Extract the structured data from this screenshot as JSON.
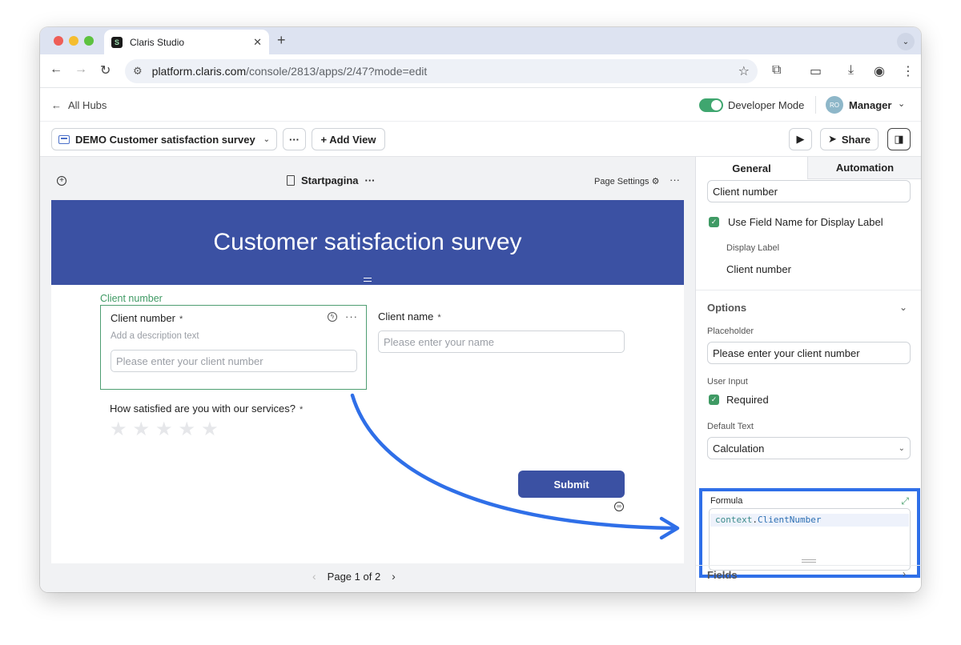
{
  "browser": {
    "tab_title": "Claris Studio",
    "tab_favicon": "S",
    "new_tab": "+",
    "tab_close": "✕",
    "url_host": "platform.claris.com",
    "url_path": "/console/2813/apps/2/47?mode=edit"
  },
  "app_header": {
    "back_label": "All Hubs",
    "developer_mode_label": "Developer Mode",
    "developer_mode_on": true,
    "avatar_initials": "RO",
    "user_role": "Manager"
  },
  "toolbar": {
    "view_name": "DEMO Customer satisfaction survey",
    "more_label": "···",
    "add_view_label": "+ Add View",
    "share_label": "Share"
  },
  "canvas": {
    "page_name": "Startpagina",
    "page_settings_label": "Page Settings",
    "banner_title": "Customer satisfaction survey",
    "selected_field_tag": "Client number",
    "field_client_number": {
      "label": "Client number",
      "required_mark": "*",
      "description_placeholder": "Add a description text",
      "placeholder": "Please enter your client number"
    },
    "field_client_name": {
      "label": "Client name",
      "required_mark": "*",
      "placeholder": "Please enter your name"
    },
    "field_rating": {
      "label": "How satisfied are you with our services?",
      "required_mark": "*",
      "stars": 5,
      "rating": 0
    },
    "submit_label": "Submit",
    "pagination": "Page 1 of 2"
  },
  "panel": {
    "tabs": [
      {
        "label": "General",
        "active": true
      },
      {
        "label": "Automation",
        "active": false
      }
    ],
    "field_name_value": "Client number",
    "use_field_name_label": "Use Field Name for Display Label",
    "display_label_caption": "Display Label",
    "display_label_value": "Client number",
    "options_section": "Options",
    "placeholder_caption": "Placeholder",
    "placeholder_value": "Please enter your client number",
    "user_input_caption": "User Input",
    "required_label": "Required",
    "default_text_caption": "Default Text",
    "default_text_value": "Calculation",
    "formula_caption": "Formula",
    "formula_object": "context",
    "formula_dot": ".",
    "formula_property": "ClientNumber",
    "fields_section": "Fields"
  },
  "colors": {
    "brand_blue": "#3b51a3",
    "accent_green": "#3f9a64",
    "highlight_blue": "#2f6fe8"
  }
}
